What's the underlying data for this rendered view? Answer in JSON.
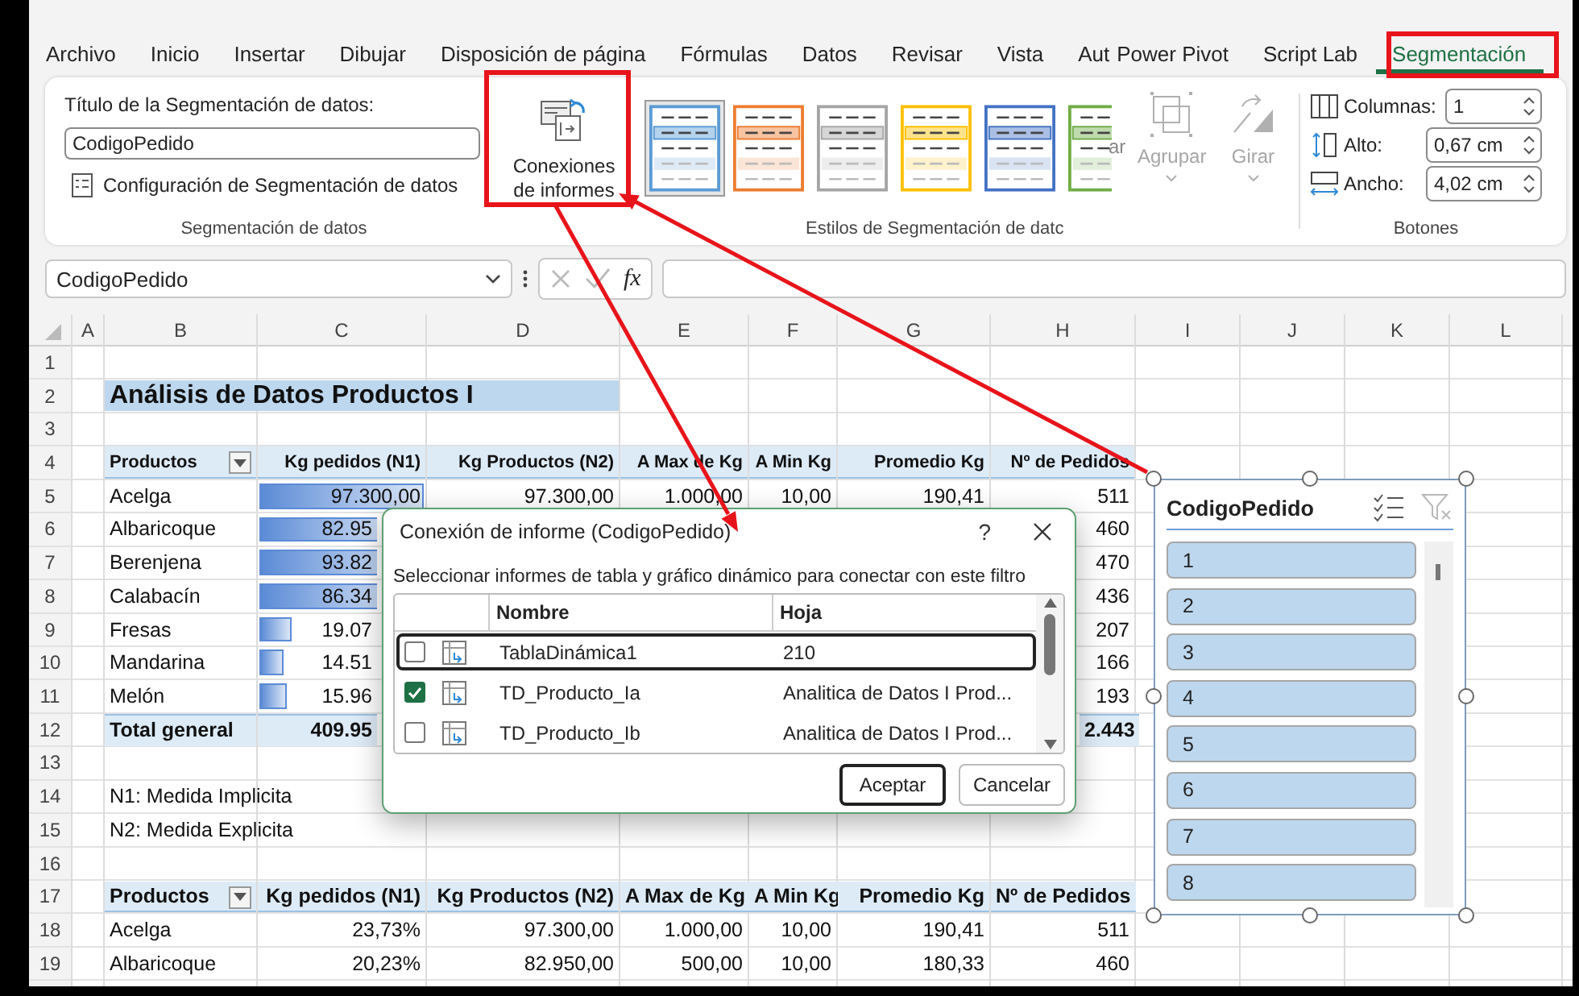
{
  "tabs": [
    {
      "label": "Archivo",
      "selected": false
    },
    {
      "label": "Inicio",
      "selected": false
    },
    {
      "label": "Insertar",
      "selected": false
    },
    {
      "label": "Dibujar",
      "selected": false
    },
    {
      "label": "Disposición de página",
      "selected": false
    },
    {
      "label": "Fórmulas",
      "selected": false
    },
    {
      "label": "Datos",
      "selected": false
    },
    {
      "label": "Revisar",
      "selected": false
    },
    {
      "label": "Vista",
      "selected": false
    },
    {
      "label": "Aut",
      "selected": false
    },
    {
      "label": "Power Pivot",
      "selected": false
    },
    {
      "label": "Script Lab",
      "selected": false
    },
    {
      "label": "Segmentación",
      "selected": true
    }
  ],
  "ribbon": {
    "caption_label": "Título de la Segmentación de datos:",
    "caption_value": "CodigoPedido",
    "settings_button": "Configuración de Segmentación de datos",
    "slicer_group_label": "Segmentación de datos",
    "connections_button": "Conexiones de informes",
    "styles": [
      {
        "color": "#5b9bd5",
        "selected": true
      },
      {
        "color": "#ed7d31",
        "selected": false
      },
      {
        "color": "#a5a5a5",
        "selected": false
      },
      {
        "color": "#ffc000",
        "selected": false
      },
      {
        "color": "#4472c4",
        "selected": false
      },
      {
        "color": "#70ad47",
        "selected": false
      }
    ],
    "clipped_label": "ar",
    "styles_group_label": "Estilos de Segmentación de datc",
    "arrange_buttons": [
      {
        "kind": "group",
        "label": "Agrupar",
        "disabled": true
      },
      {
        "kind": "rotate",
        "label": "Girar",
        "disabled": true
      }
    ],
    "size_fields": [
      {
        "kind": "columns",
        "label": "Columnas:",
        "value": "1"
      },
      {
        "kind": "height",
        "label": "Alto:",
        "value": "0,67 cm"
      },
      {
        "kind": "width",
        "label": "Ancho:",
        "value": "4,02 cm"
      }
    ],
    "buttons_group_label": "Botones"
  },
  "formula_bar": {
    "name_box": "CodigoPedido",
    "function_label": "fx"
  },
  "sheet": {
    "columns": [
      "A",
      "B",
      "C",
      "D",
      "E",
      "F",
      "G",
      "H",
      "I",
      "J",
      "K",
      "L"
    ],
    "row_numbers": [
      "1",
      "2",
      "3",
      "4",
      "5",
      "6",
      "7",
      "8",
      "9",
      "10",
      "11",
      "12",
      "13",
      "14",
      "15",
      "16",
      "17",
      "18",
      "19"
    ],
    "title": "Análisis de Datos Productos I",
    "pivot_1": {
      "headers": [
        "Productos",
        "Kg pedidos (N1)",
        "Kg Productos (N2)",
        "A Max de Kg",
        "A Min Kg",
        "Promedio Kg",
        "Nº de Pedidos"
      ],
      "rows": [
        {
          "product": "Acelga",
          "kg_pedidos": "97.300,00",
          "kg_productos": "97.300,00",
          "max_kg": "1.000,00",
          "min_kg": "10,00",
          "promedio_kg": "190,41",
          "pedidos": "511"
        },
        {
          "product": "Albaricoque",
          "kg_pedidos": "82.95",
          "pedidos": "460"
        },
        {
          "product": "Berenjena",
          "kg_pedidos": "93.82",
          "pedidos": "470"
        },
        {
          "product": "Calabacín",
          "kg_pedidos": "86.34",
          "pedidos": "436"
        },
        {
          "product": "Fresas",
          "kg_pedidos": "19.07",
          "pedidos": "207"
        },
        {
          "product": "Mandarina",
          "kg_pedidos": "14.51",
          "pedidos": "166"
        },
        {
          "product": "Melón",
          "kg_pedidos": "15.96",
          "pedidos": "193"
        }
      ],
      "total": {
        "product": "Total general",
        "kg_pedidos": "409.95",
        "pedidos": "2.443"
      }
    },
    "notes": [
      "N1: Medida Implicita",
      "N2: Medida Explicita"
    ],
    "pivot_2": {
      "headers": [
        "Productos",
        "Kg pedidos (N1)",
        "Kg Productos (N2)",
        "A Max de Kg",
        "A Min Kg",
        "Promedio Kg",
        "Nº de Pedidos"
      ],
      "rows": [
        {
          "product": "Acelga",
          "kg_pedidos": "23,73%",
          "kg_productos": "97.300,00",
          "max_kg": "1.000,00",
          "min_kg": "10,00",
          "promedio_kg": "190,41",
          "pedidos": "511"
        },
        {
          "product": "Albaricoque",
          "kg_pedidos": "20,23%",
          "kg_productos": "82.950,00",
          "max_kg": "500,00",
          "min_kg": "10,00",
          "promedio_kg": "180,33",
          "pedidos": "460"
        }
      ]
    }
  },
  "dialog": {
    "title": "Conexión de informe (CodigoPedido)",
    "help": "?",
    "instruction": "Seleccionar informes de tabla y gráfico dinámico para conectar con este filtro",
    "columns": [
      "Nombre",
      "Hoja"
    ],
    "rows": [
      {
        "name": "TablaDinámica1",
        "sheet": "210",
        "checked": false,
        "focused": true
      },
      {
        "name": "TD_Producto_Ia",
        "sheet": "Analitica de Datos I Prod...",
        "checked": true,
        "focused": false
      },
      {
        "name": "TD_Producto_Ib",
        "sheet": "Analitica de Datos I Prod...",
        "checked": false,
        "focused": false
      }
    ],
    "buttons": [
      {
        "label": "Aceptar",
        "default": true
      },
      {
        "label": "Cancelar",
        "default": false
      }
    ]
  },
  "slicer": {
    "title": "CodigoPedido",
    "clear_filter_disabled": true,
    "items": [
      {
        "label": "1",
        "selected": true
      },
      {
        "label": "2",
        "selected": true
      },
      {
        "label": "3",
        "selected": true
      },
      {
        "label": "4",
        "selected": true
      },
      {
        "label": "5",
        "selected": true
      },
      {
        "label": "6",
        "selected": true
      },
      {
        "label": "7",
        "selected": true
      },
      {
        "label": "8",
        "selected": true
      }
    ]
  }
}
